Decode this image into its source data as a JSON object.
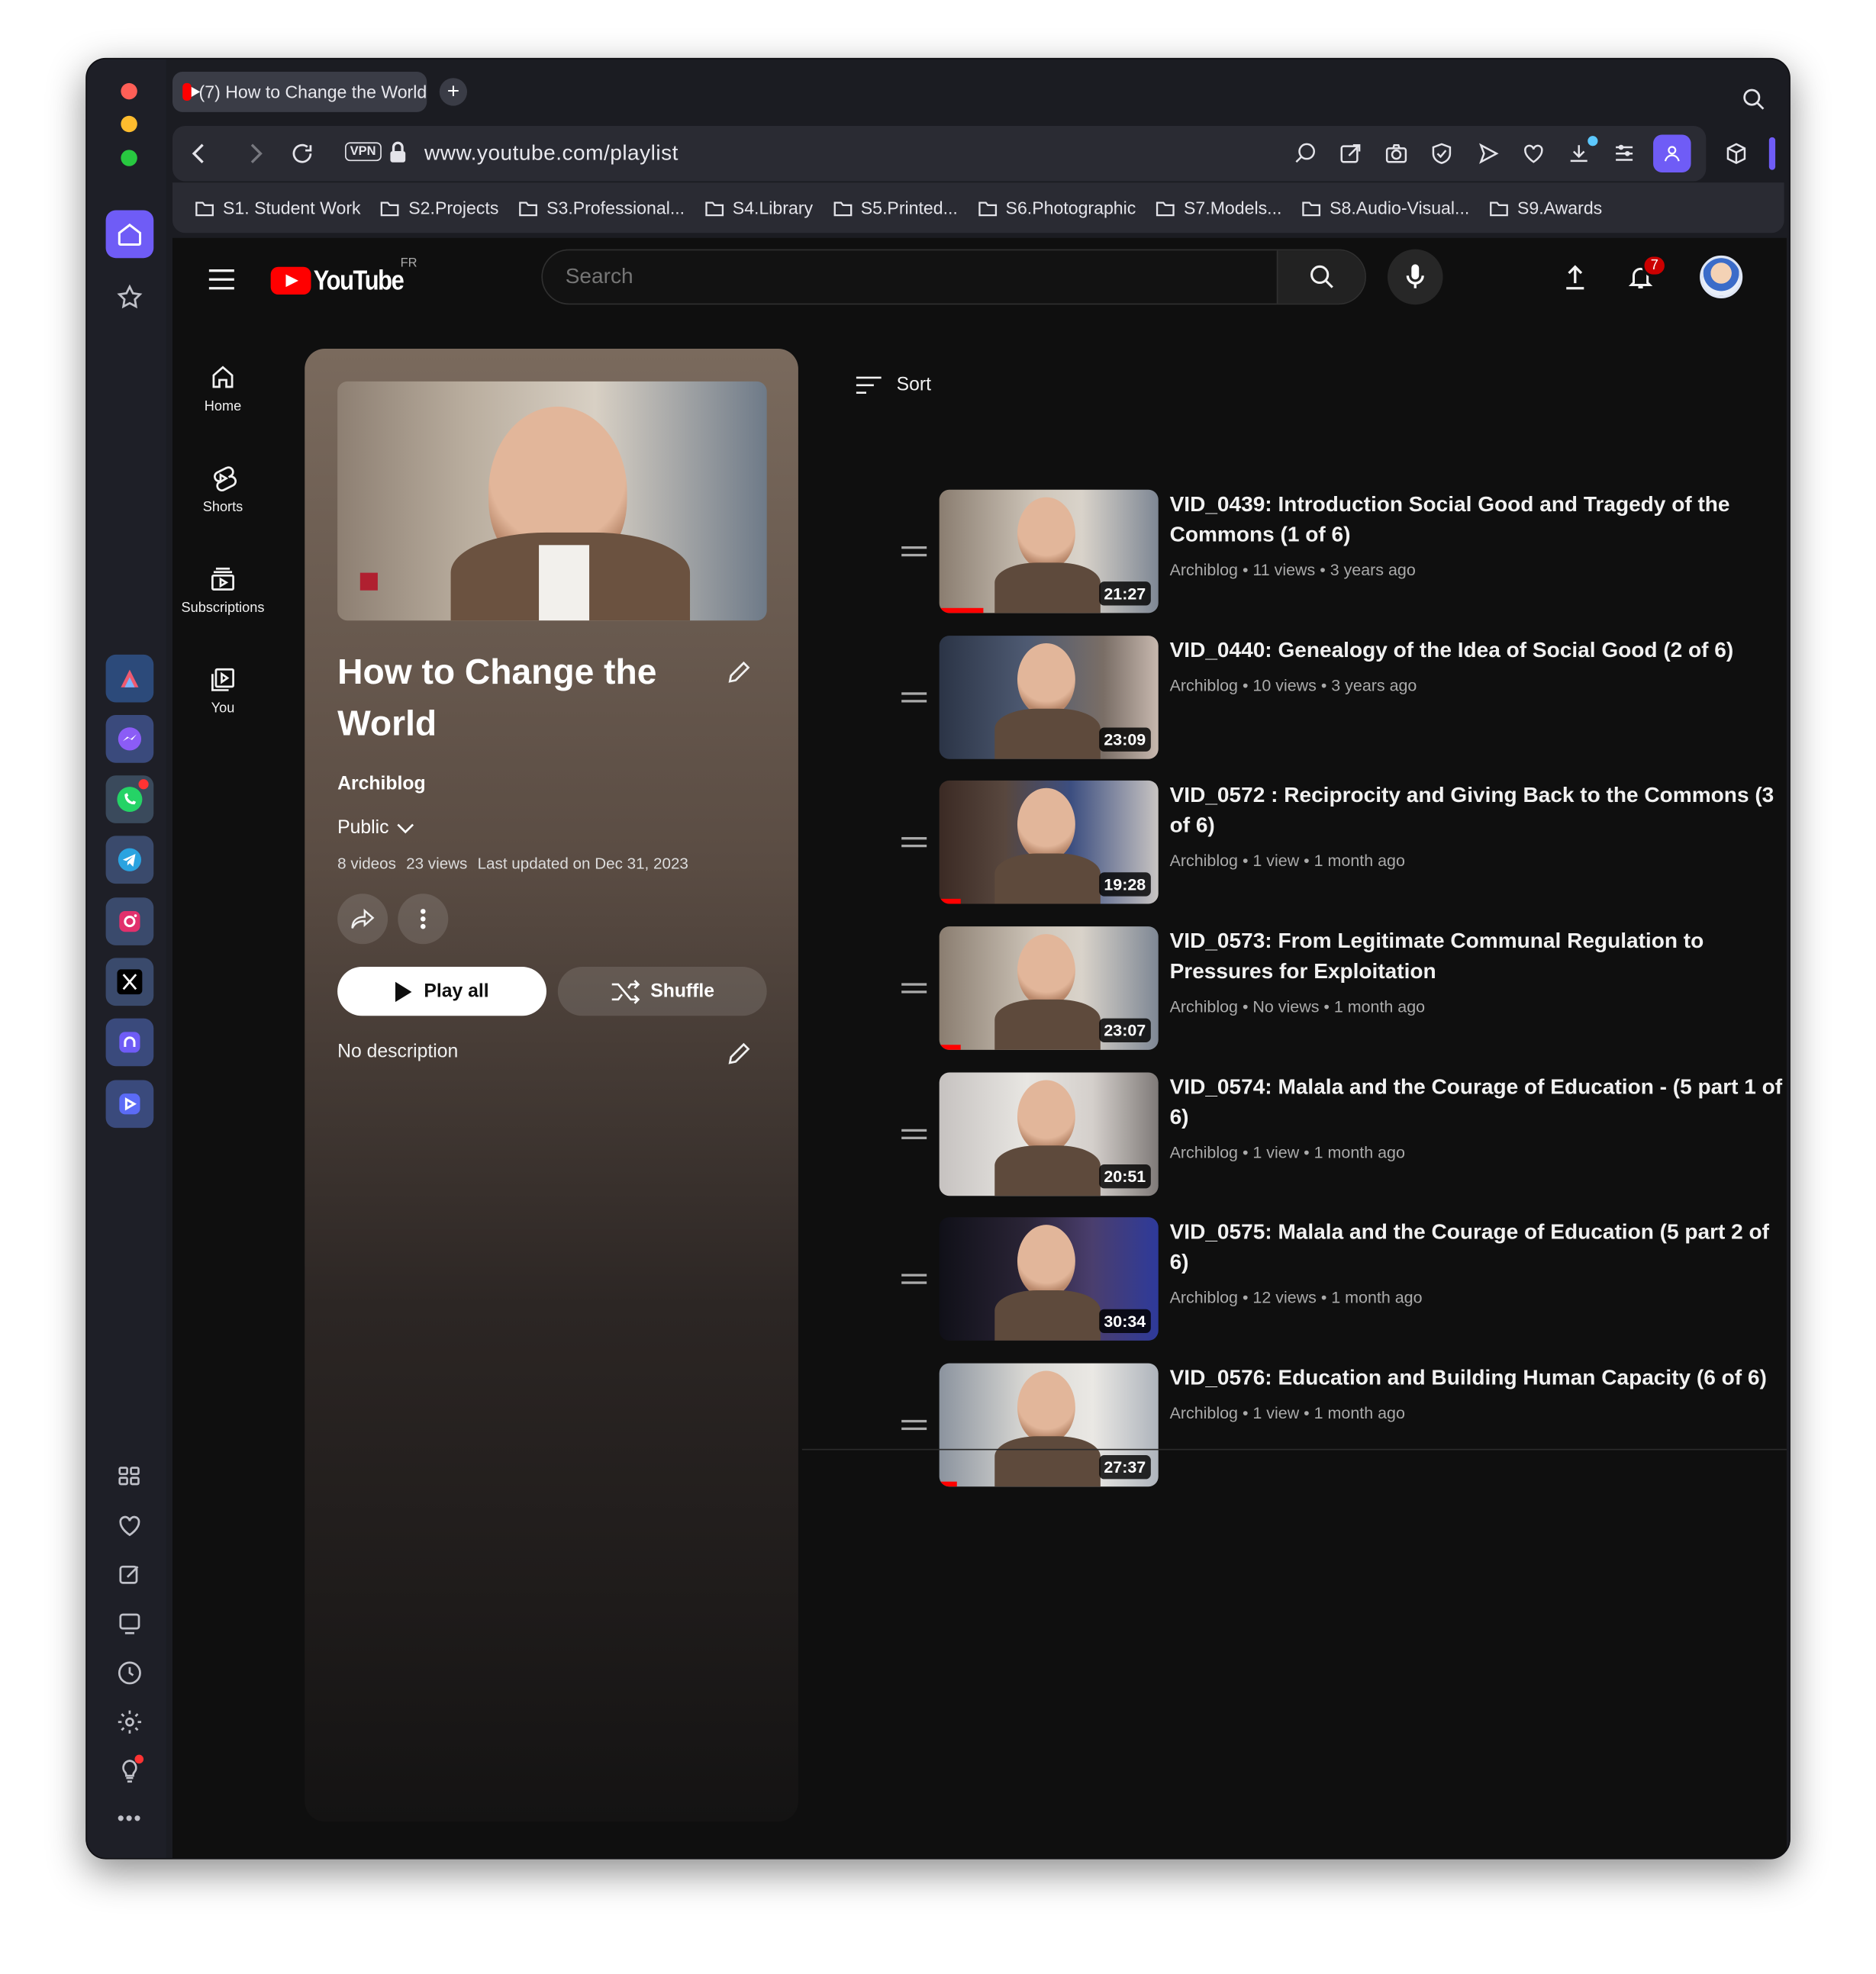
{
  "browser": {
    "tab_title": "(7) How to Change the World",
    "new_tab": "+",
    "url": "www.youtube.com/playlist",
    "vpn_badge": "VPN",
    "bookmarks": [
      "S1. Student Work",
      "S2.Projects",
      "S3.Professional...",
      "S4.Library",
      "S5.Printed...",
      "S6.Photographic",
      "S7.Models...",
      "S8.Audio-Visual...",
      "S9.Awards"
    ],
    "more_label": "•••"
  },
  "youtube": {
    "logo_text": "YouTube",
    "region": "FR",
    "search_placeholder": "Search",
    "notification_count": "7",
    "nav": [
      {
        "label": "Home",
        "icon": "home-icon"
      },
      {
        "label": "Shorts",
        "icon": "shorts-icon"
      },
      {
        "label": "Subscriptions",
        "icon": "subscriptions-icon"
      },
      {
        "label": "You",
        "icon": "you-icon"
      }
    ]
  },
  "playlist": {
    "title": "How to Change the World",
    "owner": "Archiblog",
    "visibility": "Public",
    "video_count": "8 videos",
    "views": "23 views",
    "last_updated": "Last updated on Dec 31, 2023",
    "play_all_label": "Play all",
    "shuffle_label": "Shuffle",
    "description": "No description",
    "sort_label": "Sort"
  },
  "videos": [
    {
      "title": "VID_0439: Introduction Social Good and Tragedy of the Commons (1 of 6)",
      "channel": "Archiblog",
      "stats": "11 views • 3 years ago",
      "duration": "21:27",
      "progress": 0.2
    },
    {
      "title": "VID_0440: Genealogy of the Idea of Social Good (2 of 6)",
      "channel": "Archiblog",
      "stats": "10 views • 3 years ago",
      "duration": "23:09",
      "progress": 0
    },
    {
      "title": "VID_0572 : Reciprocity and Giving Back to the Commons (3 of 6)",
      "channel": "Archiblog",
      "stats": "1 view • 1 month ago",
      "duration": "19:28",
      "progress": 0.1
    },
    {
      "title": "VID_0573: From Legitimate Communal Regulation to Pressures for Exploitation",
      "channel": "Archiblog",
      "stats": "No views • 1 month ago",
      "duration": "23:07",
      "progress": 0.1
    },
    {
      "title": "VID_0574: Malala and the Courage of Education - (5 part 1 of 6)",
      "channel": "Archiblog",
      "stats": "1 view • 1 month ago",
      "duration": "20:51",
      "progress": 0
    },
    {
      "title": "VID_0575: Malala and the Courage of Education (5 part 2 of 6)",
      "channel": "Archiblog",
      "stats": "12 views • 1 month ago",
      "duration": "30:34",
      "progress": 0
    },
    {
      "title": "VID_0576: Education and Building Human Capacity (6 of 6)",
      "channel": "Archiblog",
      "stats": "1 view • 1 month ago",
      "duration": "27:37",
      "progress": 0.08
    }
  ],
  "colors": {
    "accent": "#ff0000",
    "browser_accent": "#6f5cf6",
    "bg": "#0f0f0f"
  }
}
